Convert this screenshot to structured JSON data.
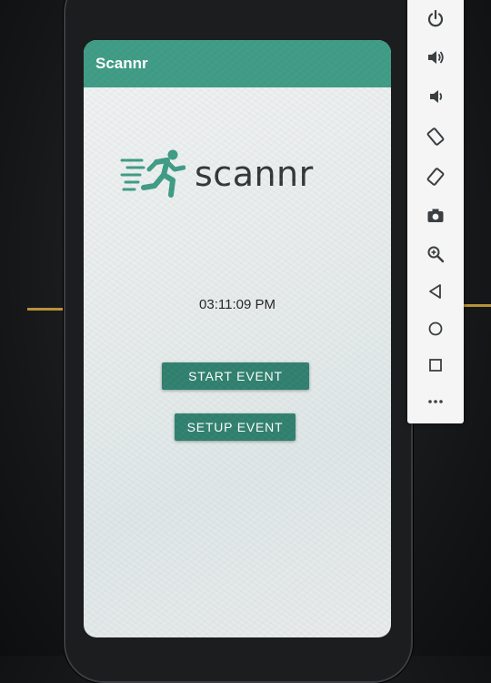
{
  "app": {
    "title": "Scannr",
    "logo_text": "scannr",
    "clock": "03:11:09 PM",
    "accent_color": "#3d9b83",
    "button_color": "#2e7f6c"
  },
  "buttons": {
    "start_label": "START EVENT",
    "setup_label": "SETUP EVENT"
  },
  "emulator_toolbar": {
    "icons": [
      "power-icon",
      "volume-up-icon",
      "volume-down-icon",
      "rotate-left-icon",
      "rotate-right-icon",
      "camera-icon",
      "zoom-icon",
      "back-icon",
      "home-icon",
      "overview-icon",
      "more-icon"
    ]
  }
}
